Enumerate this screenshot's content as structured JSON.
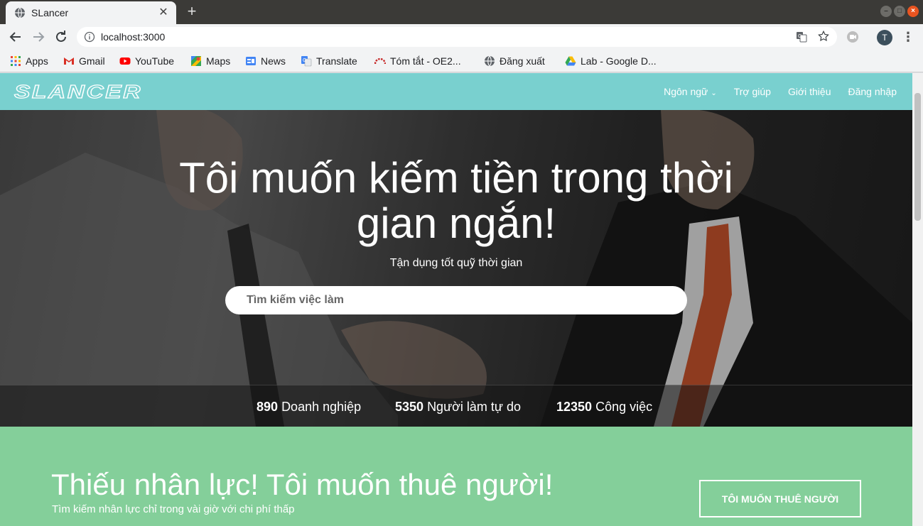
{
  "browser": {
    "tab_title": "SLancer",
    "url": "localhost:3000",
    "profile_initial": "T",
    "bookmarks": [
      "Apps",
      "Gmail",
      "YouTube",
      "Maps",
      "News",
      "Translate",
      "Tóm tắt - OE2...",
      "Đăng xuất",
      "Lab - Google D..."
    ]
  },
  "site": {
    "nav": {
      "language": "Ngôn ngữ",
      "help": "Trợ giúp",
      "about": "Giới thiệu",
      "login": "Đăng nhập"
    },
    "hero": {
      "title": "Tôi muốn kiếm tiền trong thời gian ngắn!",
      "subtitle": "Tận dụng tốt quỹ thời gian",
      "search_placeholder": "Tìm kiếm việc làm"
    },
    "stats": [
      {
        "value": "890",
        "label": "Doanh nghiệp"
      },
      {
        "value": "5350",
        "label": "Người làm tự do"
      },
      {
        "value": "12350",
        "label": "Công việc"
      }
    ],
    "hire": {
      "title": "Thiếu nhân lực! Tôi muốn thuê người!",
      "subtitle": "Tìm kiếm nhân lực chỉ trong vài giờ với chi phí thấp",
      "button": "TÔI MUỐN THUÊ NGƯỜI"
    }
  },
  "colors": {
    "nav_bg": "#79d0cf",
    "hire_bg": "#84cf9a"
  }
}
